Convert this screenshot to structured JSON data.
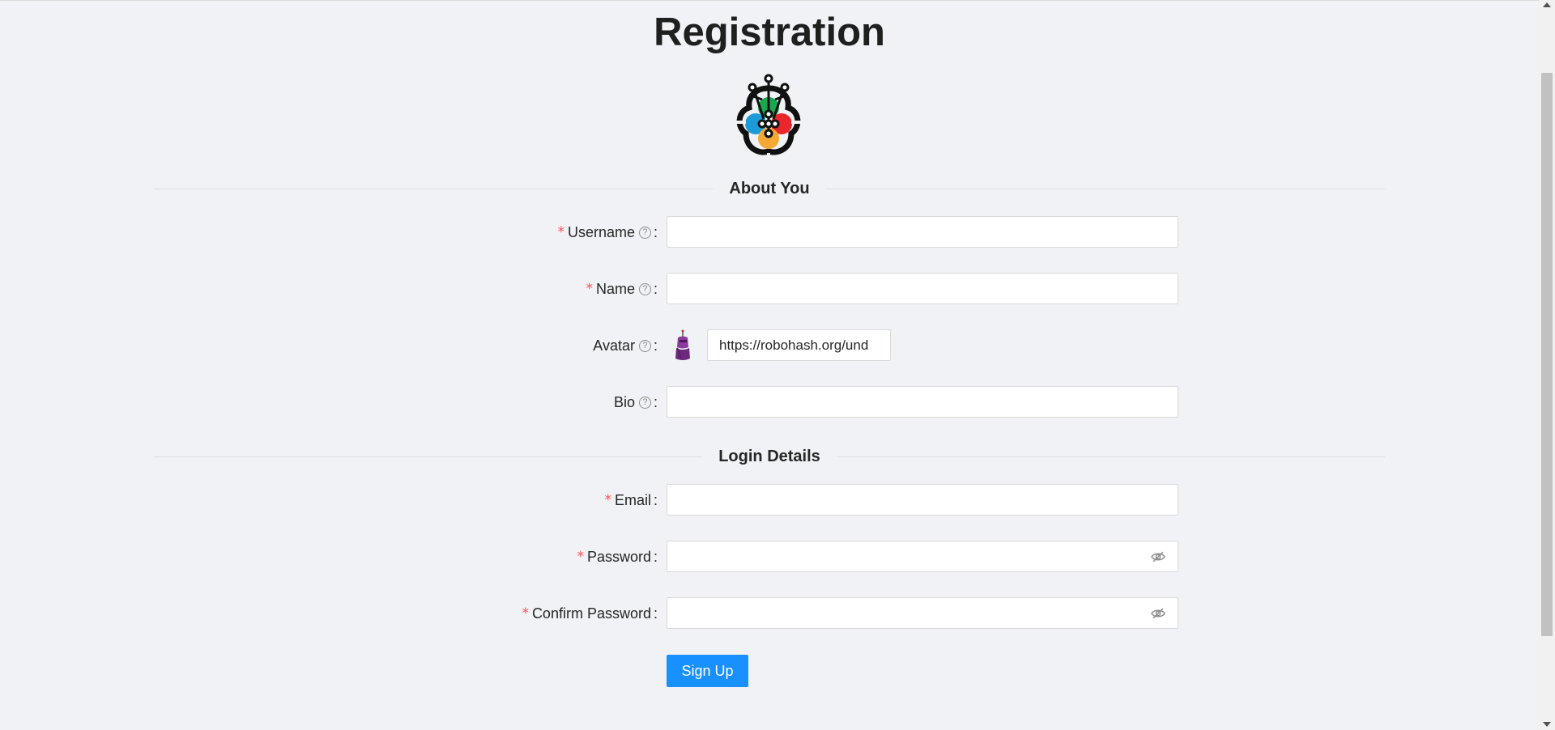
{
  "page": {
    "title": "Registration"
  },
  "sections": {
    "about": "About You",
    "login": "Login Details"
  },
  "fields": {
    "username": {
      "label": "Username",
      "required": true,
      "help": "?",
      "value": ""
    },
    "name": {
      "label": "Name",
      "required": true,
      "help": "?",
      "value": ""
    },
    "avatar": {
      "label": "Avatar",
      "required": false,
      "help": "?",
      "value": "https://robohash.org/und"
    },
    "bio": {
      "label": "Bio",
      "required": false,
      "help": "?",
      "value": ""
    },
    "email": {
      "label": "Email",
      "required": true,
      "value": ""
    },
    "password": {
      "label": "Password",
      "required": true,
      "value": ""
    },
    "confirm_password": {
      "label": "Confirm Password",
      "required": true,
      "value": ""
    }
  },
  "required_mark": "*",
  "colon": ":",
  "submit_label": "Sign Up",
  "icons": {
    "help": "question-circle-icon",
    "password_toggle": "eye-invisible-icon",
    "logo": "logo-icon",
    "avatar": "robot-avatar-icon"
  },
  "colors": {
    "primary": "#1890ff",
    "required": "#ff4d4f",
    "background": "#f0f2f5"
  }
}
